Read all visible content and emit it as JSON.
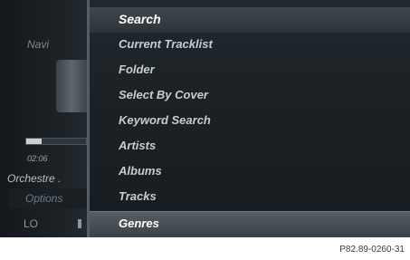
{
  "left_panel": {
    "source_label": "Navi",
    "elapsed_time": "02:06",
    "progress": 0.25,
    "track_title": "Orchestre .",
    "options_label": "Options",
    "sound_label": "LO"
  },
  "menu": {
    "items": [
      {
        "label": "Search",
        "state": "header"
      },
      {
        "label": "Current Tracklist",
        "state": "normal"
      },
      {
        "label": "Folder",
        "state": "normal"
      },
      {
        "label": "Select By Cover",
        "state": "normal"
      },
      {
        "label": "Keyword Search",
        "state": "normal"
      },
      {
        "label": "Artists",
        "state": "normal"
      },
      {
        "label": "Albums",
        "state": "normal"
      },
      {
        "label": "Tracks",
        "state": "normal"
      },
      {
        "label": "Genres",
        "state": "selected"
      }
    ]
  },
  "figure_ref": "P82.89-0260-31"
}
